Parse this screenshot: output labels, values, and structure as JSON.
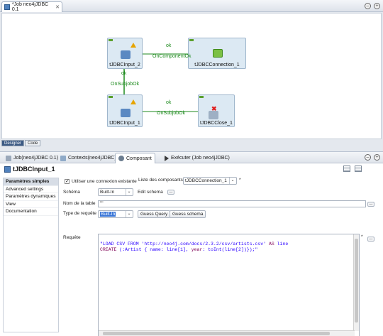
{
  "editor": {
    "tab_title": "*Job neo4jJDBC 0.1",
    "tab_close": "✕",
    "components": {
      "input2": "tJDBCInput_2",
      "connection1": "tJDBCConnection_1",
      "input1": "tJDBCInput_1",
      "close1": "tJDBCClose_1"
    },
    "links": {
      "ok_top": "ok",
      "on_component_ok": "OnComponentOk",
      "ok_vertical": "ok",
      "on_subjob_ok_vertical": "OnSubjobOk",
      "ok_bottom": "ok",
      "on_subjob_ok_bottom": "OnSubjobOk"
    },
    "subtabs": [
      "Designer",
      "Code"
    ]
  },
  "panel": {
    "tabs": [
      "Job(neo4jJDBC 0.1)",
      "Contexts(neo4jJDBC)",
      "Composant",
      "Exécuter (Job neo4jJDBC)"
    ],
    "component_title": "tJDBCInput_1",
    "sidebar": [
      "Paramètres simples",
      "Advanced settings",
      "Paramètres dynamiques",
      "View",
      "Documentation"
    ],
    "form": {
      "use_existing_label": "Utiliser une connexion existante",
      "components_list_label": "Liste des composants",
      "components_list_value": "tJDBCConnection_1",
      "asterisk": "*",
      "schema_label": "Schéma",
      "schema_value": "Built-In",
      "edit_schema_label": "Edit schema",
      "table_name_label": "Nom de la table",
      "table_name_value": "\"\"",
      "query_type_label": "Type de requête",
      "query_type_value": "Built-In",
      "guess_query": "Guess Query",
      "guess_schema": "Guess schema",
      "query_label": "Requête",
      "side_btn": "...",
      "query_line1_a": "\"LOAD CSV FROM 'http://neo4j.com/docs/2.3.2/csv/artists.csv' ",
      "query_line1_kw": "AS",
      "query_line1_b": " line",
      "query_line2_kw": "CREATE",
      "query_line2_a": " (:Artist { name: line[1], ",
      "query_line2_kw2": "year",
      "query_line2_b": ": toInt(line[2])});\""
    }
  },
  "colors": {
    "accent": "#3c5a84",
    "link": "#1d8a1d",
    "error": "#e02020",
    "warning": "#e6a400"
  }
}
